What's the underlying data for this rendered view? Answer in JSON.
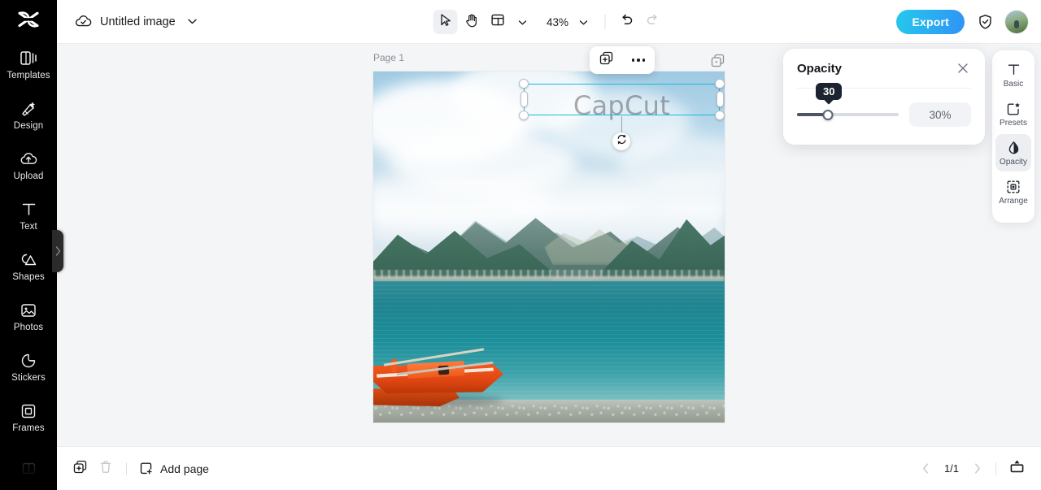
{
  "app": {
    "logo_icon": "capcut-logo-icon"
  },
  "left_sidebar": {
    "items": [
      {
        "label": "Templates",
        "icon": "templates-icon"
      },
      {
        "label": "Design",
        "icon": "design-icon"
      },
      {
        "label": "Upload",
        "icon": "upload-cloud-icon"
      },
      {
        "label": "Text",
        "icon": "text-icon"
      },
      {
        "label": "Shapes",
        "icon": "shapes-icon"
      },
      {
        "label": "Photos",
        "icon": "photos-icon"
      },
      {
        "label": "Stickers",
        "icon": "stickers-icon"
      },
      {
        "label": "Frames",
        "icon": "frames-icon"
      }
    ],
    "collapse_icon": "chevron-right-icon"
  },
  "topbar": {
    "cloud_icon": "cloud-saved-icon",
    "doc_title": "Untitled image",
    "title_caret_icon": "chevron-down-icon",
    "tools": {
      "select_icon": "cursor-select-icon",
      "hand_icon": "hand-pan-icon",
      "layout_icon": "layout-grid-icon",
      "layout_caret_icon": "chevron-down-icon",
      "zoom_value": "43%",
      "zoom_caret_icon": "chevron-down-icon",
      "undo_icon": "undo-icon",
      "redo_icon": "redo-icon"
    },
    "export_label": "Export",
    "shield_icon": "shield-check-icon",
    "avatar_icon": "avatar"
  },
  "canvas": {
    "page_label": "Page 1",
    "top_right_icon": "duplicate-page-icon",
    "text_element": "CapCut",
    "object_toolbar": {
      "duplicate_icon": "duplicate-icon",
      "more_icon": "more-options-icon"
    },
    "rotate_icon": "rotate-handle-icon"
  },
  "opacity_panel": {
    "title": "Opacity",
    "close_icon": "close-icon",
    "tooltip_value": "30",
    "value_text": "30%",
    "slider_percent": 30,
    "accent_color": "#4b5563"
  },
  "right_rail": {
    "items": [
      {
        "label": "Basic",
        "icon": "text-basic-icon",
        "active": false
      },
      {
        "label": "Presets",
        "icon": "presets-icon",
        "active": false
      },
      {
        "label": "Opacity",
        "icon": "opacity-drop-icon",
        "active": true
      },
      {
        "label": "Arrange",
        "icon": "arrange-icon",
        "active": false
      }
    ]
  },
  "bottombar": {
    "duplicate_icon": "duplicate-page-icon",
    "delete_icon": "trash-icon",
    "add_page_icon": "add-page-icon",
    "add_page_label": "Add page",
    "prev_icon": "chevron-left-icon",
    "page_count": "1/1",
    "next_icon": "chevron-right-icon",
    "present_icon": "present-icon"
  },
  "colors": {
    "export_gradient_from": "#25c9ec",
    "export_gradient_to": "#2f93f6",
    "selection_border": "#13bdd9",
    "rail_background": "#000000",
    "workspace_background": "#f4f5f7"
  }
}
